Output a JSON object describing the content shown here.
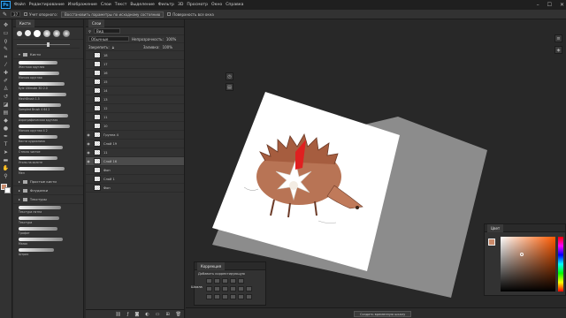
{
  "menu": {
    "logo": "Ps",
    "items": [
      "Файл",
      "Редактирование",
      "Изображение",
      "Слои",
      "Текст",
      "Выделение",
      "Фильтр",
      "3D",
      "Просмотр",
      "Окно",
      "Справка"
    ]
  },
  "options": {
    "tool_size": "37",
    "check1": "Учет опорного:",
    "btn1": "Восстановить параметры по исходному состоянию",
    "btn2": "Поверхность все окна"
  },
  "brushes": {
    "tab": "Кисти",
    "root_folder": "Кисти",
    "items": [
      {
        "label": "Жесткая круглая",
        "w": 44
      },
      {
        "label": "Мягкая круглая",
        "w": 46
      },
      {
        "label": "Kyle Ultimate 3D 2.0",
        "w": 52
      },
      {
        "label": "MechBrush 1.5",
        "w": 54
      },
      {
        "label": "Sampled Brush 4 64 2",
        "w": 48
      },
      {
        "label": "Аэрографическая круглая",
        "w": 56
      },
      {
        "label": "Мягкая круглая 4 2",
        "w": 58
      },
      {
        "label": "Кисти художника",
        "w": 44
      },
      {
        "label": "Стекло чистое",
        "w": 50
      },
      {
        "label": "Уголь на холсте",
        "w": 44
      },
      {
        "label": "Мел",
        "w": 52
      }
    ],
    "folders": [
      "Простые кисти",
      "Флудилки",
      "Текстуры"
    ],
    "sub_items": [
      {
        "label": "Текстура пятна",
        "w": 48
      },
      {
        "label": "Текстура",
        "w": 46
      },
      {
        "label": "Графит",
        "w": 44
      },
      {
        "label": "Мазок",
        "w": 50
      },
      {
        "label": "Штрих",
        "w": 40
      }
    ]
  },
  "layers": {
    "tab": "Слои",
    "filter": "Вид",
    "blend_mode": "Обычные",
    "opacity_label": "Непрозрачность:",
    "opacity": "100%",
    "lock_label": "Закрепить:",
    "fill_label": "Заливка:",
    "fill": "100%",
    "rows": [
      {
        "name": "18",
        "selected": false,
        "visible": false
      },
      {
        "name": "17",
        "selected": false,
        "visible": false
      },
      {
        "name": "16",
        "selected": false,
        "visible": false
      },
      {
        "name": "15",
        "selected": false,
        "visible": false
      },
      {
        "name": "14",
        "selected": false,
        "visible": false
      },
      {
        "name": "13",
        "selected": false,
        "visible": false
      },
      {
        "name": "12",
        "selected": false,
        "visible": false
      },
      {
        "name": "11",
        "selected": false,
        "visible": false
      },
      {
        "name": "10",
        "selected": false,
        "visible": false
      },
      {
        "name": "Группа 4",
        "selected": false,
        "visible": true
      },
      {
        "name": "Слой 19",
        "selected": false,
        "visible": true
      },
      {
        "name": "11",
        "selected": false,
        "visible": true
      },
      {
        "name": "Слой 16",
        "selected": true,
        "visible": true
      },
      {
        "name": "Фон",
        "selected": false,
        "visible": false
      },
      {
        "name": "Слой 1",
        "selected": false,
        "visible": false
      },
      {
        "name": "Фон",
        "selected": false,
        "visible": false
      }
    ]
  },
  "corrections": {
    "title": "Коррекция",
    "subtitle": "Добавить корректирующую"
  },
  "color": {
    "title": "Цвет",
    "fg": "#c98a6a",
    "bg": "#ffffff"
  },
  "bottom": {
    "tab": "Шкала",
    "btn": "Создать временную шкалу"
  },
  "colors": {
    "canvas_bg": "#282828",
    "paper": "#ffffff",
    "gray_block": "#8f8f8f",
    "hedgehog": "#b86e4d",
    "gnome_hat": "#e02020"
  }
}
